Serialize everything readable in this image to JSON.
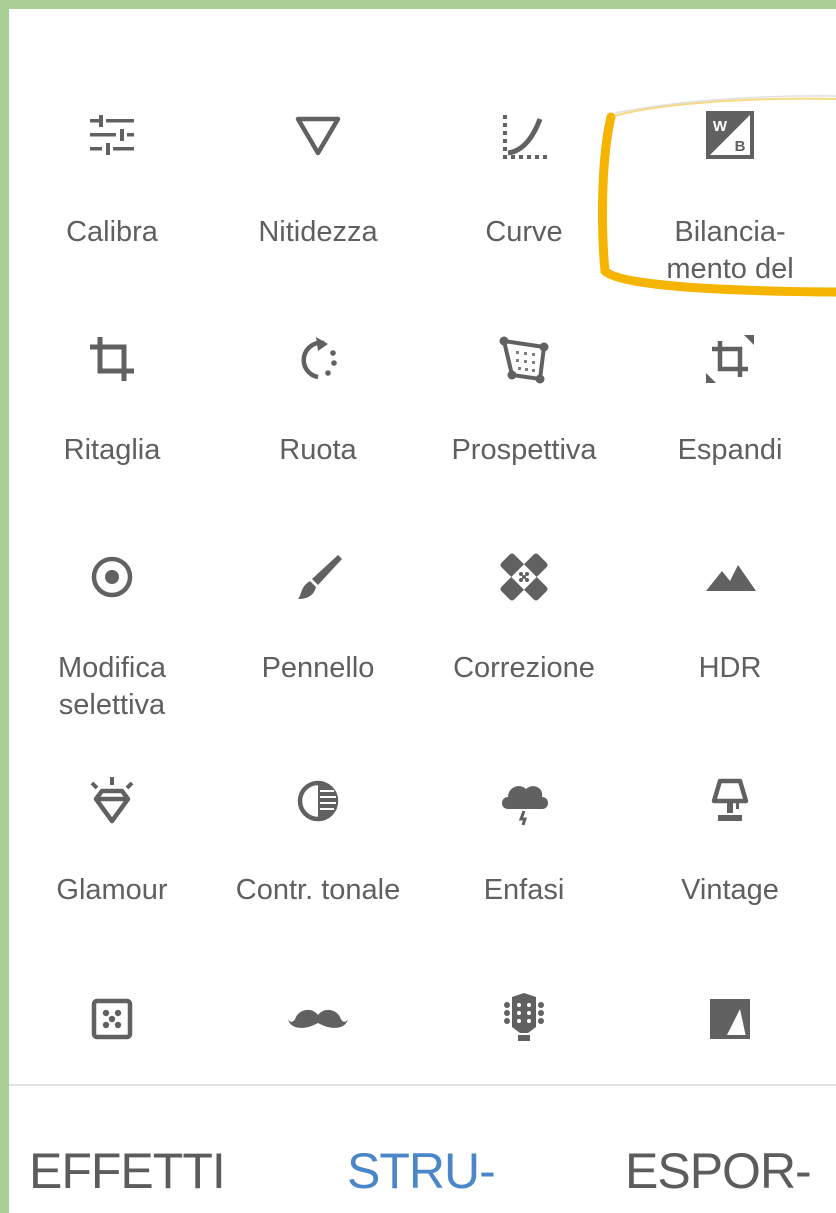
{
  "tools": [
    {
      "label": "Calibra",
      "icon": "tune-icon"
    },
    {
      "label": "Nitidezza",
      "icon": "triangle-icon"
    },
    {
      "label": "Curve",
      "icon": "curve-icon"
    },
    {
      "label": "Bilancia-\nmento del",
      "icon": "white-balance-icon"
    },
    {
      "label": "Ritaglia",
      "icon": "crop-icon"
    },
    {
      "label": "Ruota",
      "icon": "rotate-icon"
    },
    {
      "label": "Prospettiva",
      "icon": "perspective-icon"
    },
    {
      "label": "Espandi",
      "icon": "expand-icon"
    },
    {
      "label": "Modifica\nselettiva",
      "icon": "selective-icon"
    },
    {
      "label": "Pennello",
      "icon": "brush-icon"
    },
    {
      "label": "Correzione",
      "icon": "healing-icon"
    },
    {
      "label": "HDR",
      "icon": "mountains-icon"
    },
    {
      "label": "Glamour",
      "icon": "diamond-icon"
    },
    {
      "label": "Contr. tonale",
      "icon": "tonal-contrast-icon"
    },
    {
      "label": "Enfasi",
      "icon": "storm-cloud-icon"
    },
    {
      "label": "Vintage",
      "icon": "lamp-icon"
    },
    {
      "label": "",
      "icon": "grainy-film-icon"
    },
    {
      "label": "",
      "icon": "mustache-icon"
    },
    {
      "label": "",
      "icon": "guitar-head-icon"
    },
    {
      "label": "",
      "icon": "black-white-icon"
    }
  ],
  "nav": {
    "effects": "EFFETTI",
    "tools": "STRU-",
    "export": "ESPOR-"
  },
  "colors": {
    "background_frame": "#a9cf94",
    "icon": "#616161",
    "label": "#5f5f5f",
    "active_tab": "#4a86c8",
    "highlight": "#f5b400"
  }
}
